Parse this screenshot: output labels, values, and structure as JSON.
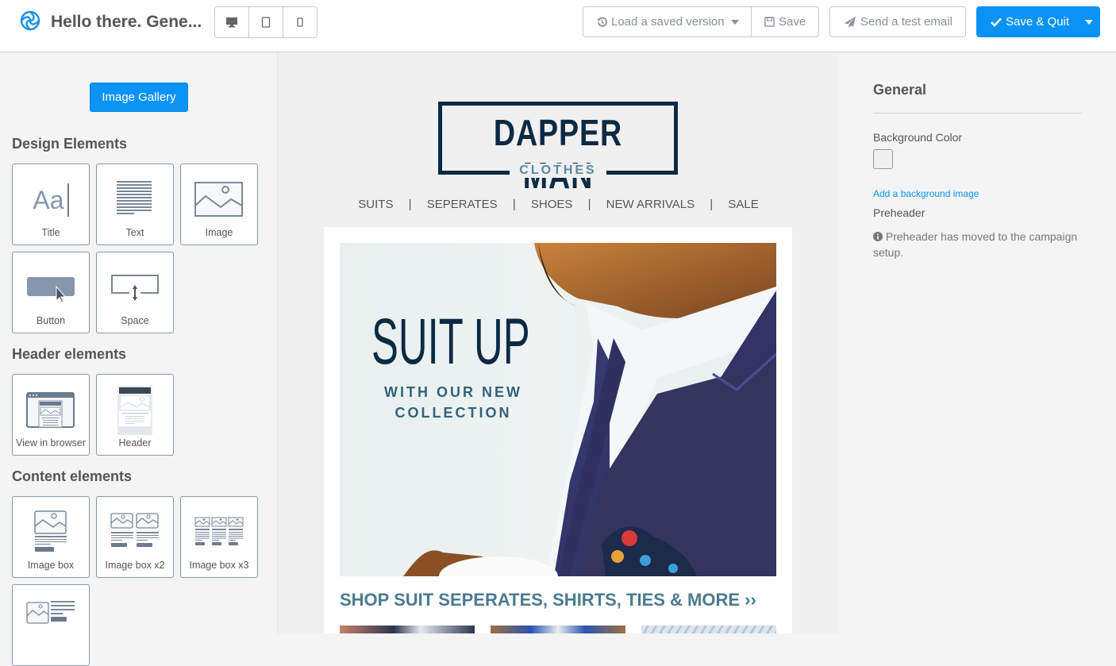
{
  "header": {
    "title": "Hello there. Gene...",
    "devices": [
      {
        "name": "desktop",
        "icon": "desktop-icon"
      },
      {
        "name": "tablet",
        "icon": "tablet-icon"
      },
      {
        "name": "mobile",
        "icon": "mobile-icon"
      }
    ],
    "load_version_label": "Load a saved version",
    "save_label": "Save",
    "test_email_label": "Send a test email",
    "save_quit_label": "Save & Quit"
  },
  "left_panel": {
    "gallery_button": "Image Gallery",
    "sections": {
      "design": {
        "title": "Design Elements",
        "items": [
          "Title",
          "Text",
          "Image",
          "Button",
          "Space"
        ]
      },
      "header": {
        "title": "Header elements",
        "items": [
          "View in browser",
          "Header"
        ]
      },
      "content": {
        "title": "Content elements",
        "items": [
          "Image box",
          "Image box x2",
          "Image box x3",
          "Image + text"
        ]
      }
    },
    "title_tile_glyph": "Aa"
  },
  "canvas": {
    "brand": {
      "name": "DAPPER MAN",
      "subtitle": "CLOTHES"
    },
    "nav": [
      "SUITS",
      "SEPERATES",
      "SHOES",
      "NEW ARRIVALS",
      "SALE"
    ],
    "nav_separator": "|",
    "hero": {
      "headline": "SUIT UP",
      "subline_1": "WITH OUR NEW",
      "subline_2": "COLLECTION"
    },
    "cta": "SHOP SUIT SEPERATES, SHIRTS, TIES & MORE ››",
    "colors": {
      "brand_navy": "#0d2a43",
      "brand_teal": "#4b7a91"
    }
  },
  "right_panel": {
    "title": "General",
    "background_color_label": "Background Color",
    "background_color_value": "#f0f0f0",
    "background_image_link": "Add a background image",
    "preheader_label": "Preheader",
    "preheader_info": "Preheader has moved to the campaign setup."
  },
  "colors": {
    "accent": "#0a93f5",
    "icon_gray": "#7a8799"
  }
}
